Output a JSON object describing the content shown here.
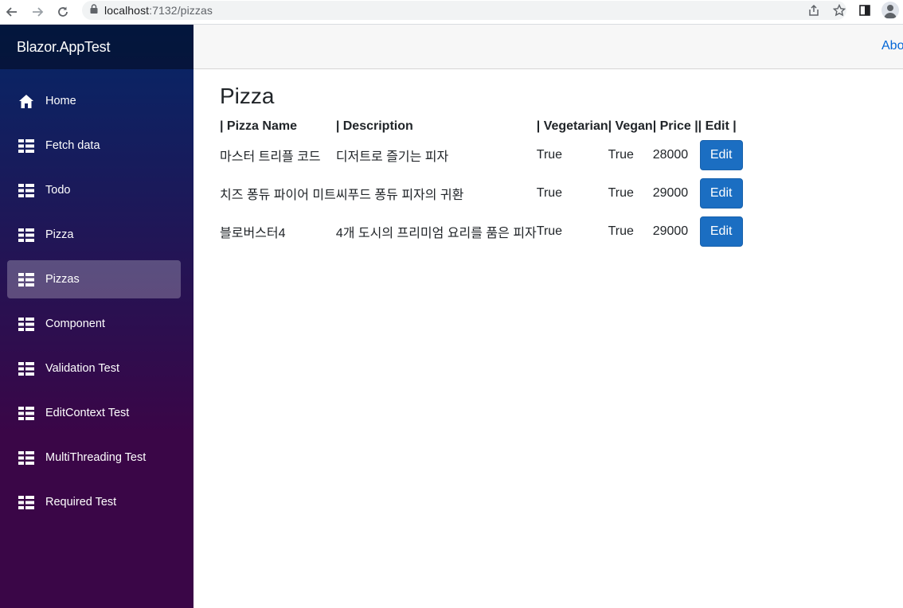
{
  "browser": {
    "url_host": "localhost",
    "url_path": ":7132/pizzas"
  },
  "sidebar": {
    "brand": "Blazor.AppTest",
    "items": [
      {
        "label": "Home",
        "icon": "home-icon"
      },
      {
        "label": "Fetch data",
        "icon": "list-icon"
      },
      {
        "label": "Todo",
        "icon": "list-icon"
      },
      {
        "label": "Pizza",
        "icon": "list-icon"
      },
      {
        "label": "Pizzas",
        "icon": "list-icon",
        "active": true
      },
      {
        "label": "Component",
        "icon": "list-icon"
      },
      {
        "label": "Validation Test",
        "icon": "list-icon"
      },
      {
        "label": "EditContext Test",
        "icon": "list-icon"
      },
      {
        "label": "MultiThreading Test",
        "icon": "list-icon"
      },
      {
        "label": "Required Test",
        "icon": "list-icon"
      }
    ]
  },
  "top_row": {
    "about_label": "About"
  },
  "main": {
    "title": "Pizza",
    "headers": [
      "| Pizza Name",
      "| Description",
      "| Vegetarian",
      "| Vegan",
      "| Price |",
      "| Edit |"
    ],
    "rows": [
      {
        "name": "마스터 트리플 코드",
        "description": "디저트로 즐기는 피자",
        "vegetarian": "True",
        "vegan": "True",
        "price": "28000",
        "edit": "Edit"
      },
      {
        "name": "치즈 퐁듀 파이어 미트",
        "description": "씨푸드 퐁듀 피자의 귀환",
        "vegetarian": "True",
        "vegan": "True",
        "price": "29000",
        "edit": "Edit"
      },
      {
        "name": "블로버스터4",
        "description": "4개 도시의 프리미엄 요리를 품은 피자",
        "vegetarian": "True",
        "vegan": "True",
        "price": "29000",
        "edit": "Edit"
      }
    ]
  },
  "colors": {
    "accent": "#1b6ec2",
    "link": "#0366d6",
    "sidebar_top": "#052767",
    "sidebar_bottom": "#3a0647"
  }
}
